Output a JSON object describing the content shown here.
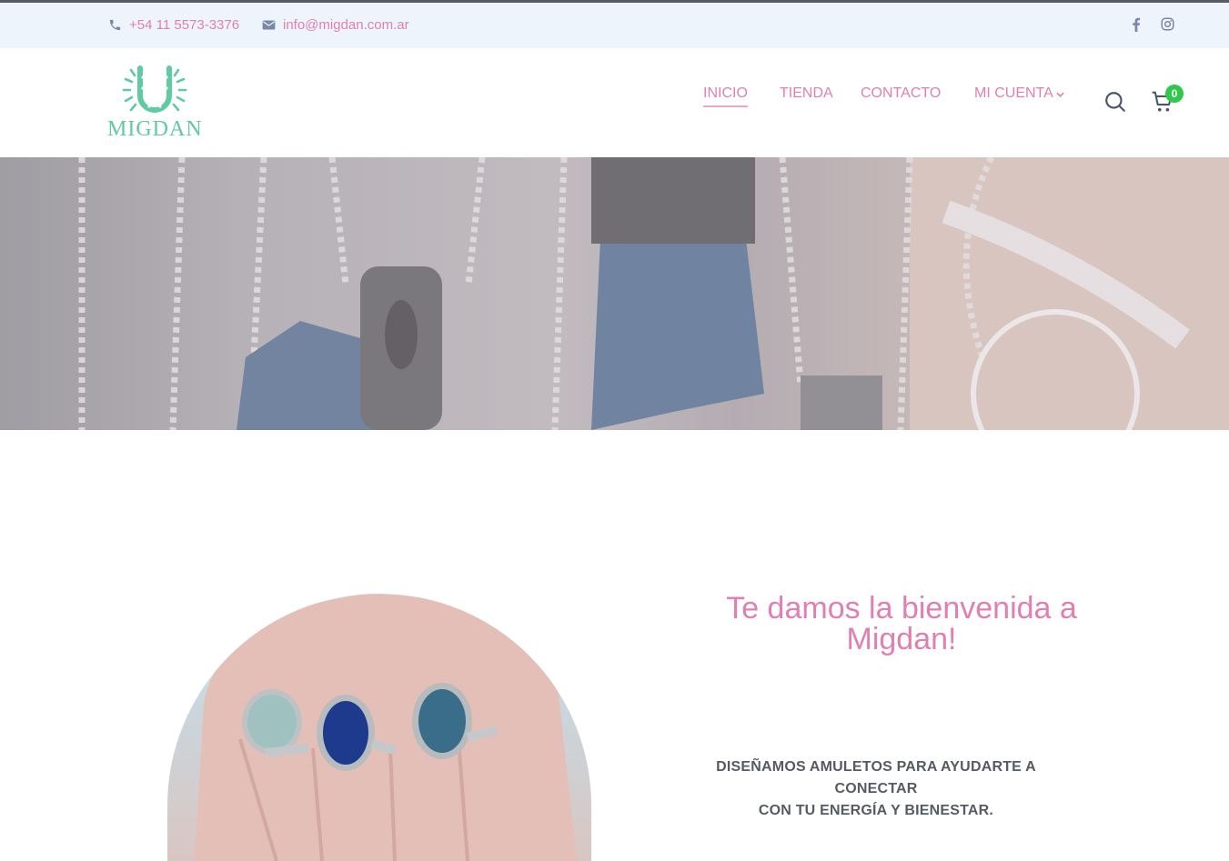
{
  "topbar": {
    "phone": "+54 11 5573-3376",
    "email": "info@migdan.com.ar",
    "social": [
      "facebook-icon",
      "instagram-icon"
    ]
  },
  "brand": {
    "name": "MIGDAN"
  },
  "nav": {
    "items": [
      {
        "label": "INICIO",
        "active": true
      },
      {
        "label": "TIENDA"
      },
      {
        "label": "CONTACTO"
      },
      {
        "label": "MI CUENTA",
        "has_dropdown": true
      }
    ]
  },
  "cart": {
    "count": "0"
  },
  "welcome": {
    "title_line1": "Te damos la bienvenida a",
    "title_line2": "Migdan!",
    "tagline_line1": "DISEÑAMOS AMULETOS PARA AYUDARTE A CONECTAR",
    "tagline_line2": "CON TU ENERGÍA Y BIENESTAR."
  },
  "colors": {
    "accent_pink": "#e17fb2",
    "logo_green": "#5ecba1",
    "topbar_bg": "#eef4fb",
    "badge_green": "#2fc84a"
  }
}
